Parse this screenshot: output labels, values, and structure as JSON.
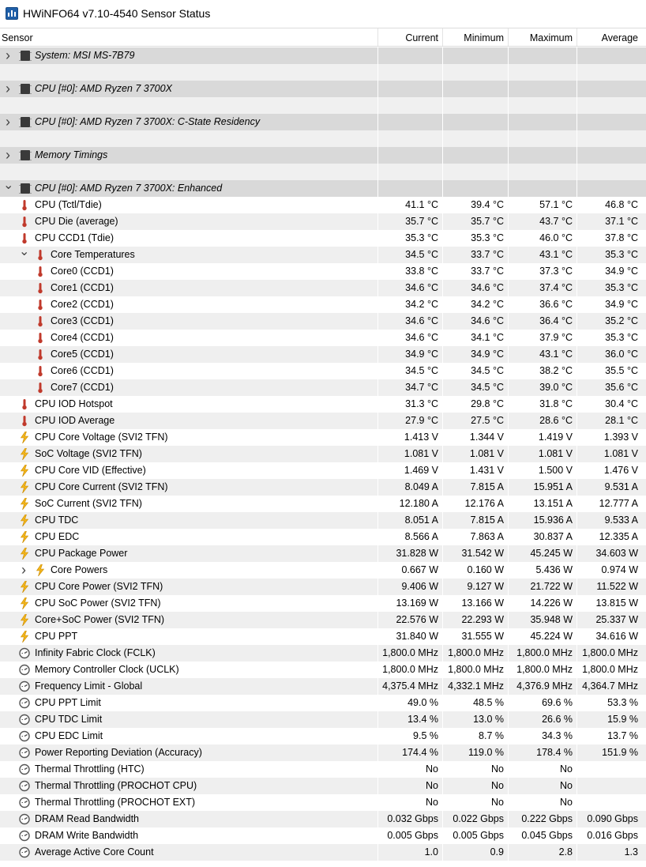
{
  "window": {
    "title": "HWiNFO64 v7.10-4540 Sensor Status"
  },
  "header": {
    "sensor": "Sensor",
    "current": "Current",
    "minimum": "Minimum",
    "maximum": "Maximum",
    "average": "Average"
  },
  "groups": [
    {
      "label": "System: MSI MS-7B79",
      "expanded": false
    },
    {
      "label": "CPU [#0]: AMD Ryzen 7 3700X",
      "expanded": false
    },
    {
      "label": "CPU [#0]: AMD Ryzen 7 3700X: C-State Residency",
      "expanded": false
    },
    {
      "label": "Memory Timings",
      "expanded": false
    },
    {
      "label": "CPU [#0]: AMD Ryzen 7 3700X: Enhanced",
      "expanded": true
    }
  ],
  "rows": [
    {
      "name": "CPU (Tctl/Tdie)",
      "icon": "thermometer-icon",
      "indent": 0,
      "current": "41.1 °C",
      "minimum": "39.4 °C",
      "maximum": "57.1 °C",
      "average": "46.8 °C"
    },
    {
      "name": "CPU Die (average)",
      "icon": "thermometer-icon",
      "indent": 0,
      "current": "35.7 °C",
      "minimum": "35.7 °C",
      "maximum": "43.7 °C",
      "average": "37.1 °C"
    },
    {
      "name": "CPU CCD1 (Tdie)",
      "icon": "thermometer-icon",
      "indent": 0,
      "current": "35.3 °C",
      "minimum": "35.3 °C",
      "maximum": "46.0 °C",
      "average": "37.8 °C"
    },
    {
      "name": "Core Temperatures",
      "icon": "thermometer-icon",
      "indent": 1,
      "chevron": "down",
      "current": "34.5 °C",
      "minimum": "33.7 °C",
      "maximum": "43.1 °C",
      "average": "35.3 °C"
    },
    {
      "name": "Core0 (CCD1)",
      "icon": "thermometer-icon",
      "indent": 1,
      "current": "33.8 °C",
      "minimum": "33.7 °C",
      "maximum": "37.3 °C",
      "average": "34.9 °C"
    },
    {
      "name": "Core1 (CCD1)",
      "icon": "thermometer-icon",
      "indent": 1,
      "current": "34.6 °C",
      "minimum": "34.6 °C",
      "maximum": "37.4 °C",
      "average": "35.3 °C"
    },
    {
      "name": "Core2 (CCD1)",
      "icon": "thermometer-icon",
      "indent": 1,
      "current": "34.2 °C",
      "minimum": "34.2 °C",
      "maximum": "36.6 °C",
      "average": "34.9 °C"
    },
    {
      "name": "Core3 (CCD1)",
      "icon": "thermometer-icon",
      "indent": 1,
      "current": "34.6 °C",
      "minimum": "34.6 °C",
      "maximum": "36.4 °C",
      "average": "35.2 °C"
    },
    {
      "name": "Core4 (CCD1)",
      "icon": "thermometer-icon",
      "indent": 1,
      "current": "34.6 °C",
      "minimum": "34.1 °C",
      "maximum": "37.9 °C",
      "average": "35.3 °C"
    },
    {
      "name": "Core5 (CCD1)",
      "icon": "thermometer-icon",
      "indent": 1,
      "current": "34.9 °C",
      "minimum": "34.9 °C",
      "maximum": "43.1 °C",
      "average": "36.0 °C"
    },
    {
      "name": "Core6 (CCD1)",
      "icon": "thermometer-icon",
      "indent": 1,
      "current": "34.5 °C",
      "minimum": "34.5 °C",
      "maximum": "38.2 °C",
      "average": "35.5 °C"
    },
    {
      "name": "Core7 (CCD1)",
      "icon": "thermometer-icon",
      "indent": 1,
      "current": "34.7 °C",
      "minimum": "34.5 °C",
      "maximum": "39.0 °C",
      "average": "35.6 °C"
    },
    {
      "name": "CPU IOD Hotspot",
      "icon": "thermometer-icon",
      "indent": 0,
      "current": "31.3 °C",
      "minimum": "29.8 °C",
      "maximum": "31.8 °C",
      "average": "30.4 °C"
    },
    {
      "name": "CPU IOD Average",
      "icon": "thermometer-icon",
      "indent": 0,
      "current": "27.9 °C",
      "minimum": "27.5 °C",
      "maximum": "28.6 °C",
      "average": "28.1 °C"
    },
    {
      "name": "CPU Core Voltage (SVI2 TFN)",
      "icon": "lightning-icon",
      "indent": 0,
      "current": "1.413 V",
      "minimum": "1.344 V",
      "maximum": "1.419 V",
      "average": "1.393 V"
    },
    {
      "name": "SoC Voltage (SVI2 TFN)",
      "icon": "lightning-icon",
      "indent": 0,
      "current": "1.081 V",
      "minimum": "1.081 V",
      "maximum": "1.081 V",
      "average": "1.081 V"
    },
    {
      "name": "CPU Core VID (Effective)",
      "icon": "lightning-icon",
      "indent": 0,
      "current": "1.469 V",
      "minimum": "1.431 V",
      "maximum": "1.500 V",
      "average": "1.476 V"
    },
    {
      "name": "CPU Core Current (SVI2 TFN)",
      "icon": "lightning-icon",
      "indent": 0,
      "current": "8.049 A",
      "minimum": "7.815 A",
      "maximum": "15.951 A",
      "average": "9.531 A"
    },
    {
      "name": "SoC Current (SVI2 TFN)",
      "icon": "lightning-icon",
      "indent": 0,
      "current": "12.180 A",
      "minimum": "12.176 A",
      "maximum": "13.151 A",
      "average": "12.777 A"
    },
    {
      "name": "CPU TDC",
      "icon": "lightning-icon",
      "indent": 0,
      "current": "8.051 A",
      "minimum": "7.815 A",
      "maximum": "15.936 A",
      "average": "9.533 A"
    },
    {
      "name": "CPU EDC",
      "icon": "lightning-icon",
      "indent": 0,
      "current": "8.566 A",
      "minimum": "7.863 A",
      "maximum": "30.837 A",
      "average": "12.335 A"
    },
    {
      "name": "CPU Package Power",
      "icon": "lightning-icon",
      "indent": 0,
      "current": "31.828 W",
      "minimum": "31.542 W",
      "maximum": "45.245 W",
      "average": "34.603 W"
    },
    {
      "name": "Core Powers",
      "icon": "lightning-icon",
      "indent": 1,
      "chevron": "right",
      "current": "0.667 W",
      "minimum": "0.160 W",
      "maximum": "5.436 W",
      "average": "0.974 W"
    },
    {
      "name": "CPU Core Power (SVI2 TFN)",
      "icon": "lightning-icon",
      "indent": 0,
      "current": "9.406 W",
      "minimum": "9.127 W",
      "maximum": "21.722 W",
      "average": "11.522 W"
    },
    {
      "name": "CPU SoC Power (SVI2 TFN)",
      "icon": "lightning-icon",
      "indent": 0,
      "current": "13.169 W",
      "minimum": "13.166 W",
      "maximum": "14.226 W",
      "average": "13.815 W"
    },
    {
      "name": "Core+SoC Power (SVI2 TFN)",
      "icon": "lightning-icon",
      "indent": 0,
      "current": "22.576 W",
      "minimum": "22.293 W",
      "maximum": "35.948 W",
      "average": "25.337 W"
    },
    {
      "name": "CPU PPT",
      "icon": "lightning-icon",
      "indent": 0,
      "current": "31.840 W",
      "minimum": "31.555 W",
      "maximum": "45.224 W",
      "average": "34.616 W"
    },
    {
      "name": "Infinity Fabric Clock (FCLK)",
      "icon": "gauge-icon",
      "indent": 0,
      "current": "1,800.0 MHz",
      "minimum": "1,800.0 MHz",
      "maximum": "1,800.0 MHz",
      "average": "1,800.0 MHz"
    },
    {
      "name": "Memory Controller Clock (UCLK)",
      "icon": "gauge-icon",
      "indent": 0,
      "current": "1,800.0 MHz",
      "minimum": "1,800.0 MHz",
      "maximum": "1,800.0 MHz",
      "average": "1,800.0 MHz"
    },
    {
      "name": "Frequency Limit - Global",
      "icon": "gauge-icon",
      "indent": 0,
      "current": "4,375.4 MHz",
      "minimum": "4,332.1 MHz",
      "maximum": "4,376.9 MHz",
      "average": "4,364.7 MHz"
    },
    {
      "name": "CPU PPT Limit",
      "icon": "gauge-icon",
      "indent": 0,
      "current": "49.0 %",
      "minimum": "48.5 %",
      "maximum": "69.6 %",
      "average": "53.3 %"
    },
    {
      "name": "CPU TDC Limit",
      "icon": "gauge-icon",
      "indent": 0,
      "current": "13.4 %",
      "minimum": "13.0 %",
      "maximum": "26.6 %",
      "average": "15.9 %"
    },
    {
      "name": "CPU EDC Limit",
      "icon": "gauge-icon",
      "indent": 0,
      "current": "9.5 %",
      "minimum": "8.7 %",
      "maximum": "34.3 %",
      "average": "13.7 %"
    },
    {
      "name": "Power Reporting Deviation (Accuracy)",
      "icon": "gauge-icon",
      "indent": 0,
      "current": "174.4 %",
      "minimum": "119.0 %",
      "maximum": "178.4 %",
      "average": "151.9 %"
    },
    {
      "name": "Thermal Throttling (HTC)",
      "icon": "gauge-icon",
      "indent": 0,
      "current": "No",
      "minimum": "No",
      "maximum": "No",
      "average": ""
    },
    {
      "name": "Thermal Throttling (PROCHOT CPU)",
      "icon": "gauge-icon",
      "indent": 0,
      "current": "No",
      "minimum": "No",
      "maximum": "No",
      "average": ""
    },
    {
      "name": "Thermal Throttling (PROCHOT EXT)",
      "icon": "gauge-icon",
      "indent": 0,
      "current": "No",
      "minimum": "No",
      "maximum": "No",
      "average": ""
    },
    {
      "name": "DRAM Read Bandwidth",
      "icon": "gauge-icon",
      "indent": 0,
      "current": "0.032 Gbps",
      "minimum": "0.022 Gbps",
      "maximum": "0.222 Gbps",
      "average": "0.090 Gbps"
    },
    {
      "name": "DRAM Write Bandwidth",
      "icon": "gauge-icon",
      "indent": 0,
      "current": "0.005 Gbps",
      "minimum": "0.005 Gbps",
      "maximum": "0.045 Gbps",
      "average": "0.016 Gbps"
    },
    {
      "name": "Average Active Core Count",
      "icon": "gauge-icon",
      "indent": 0,
      "current": "1.0",
      "minimum": "0.9",
      "maximum": "2.8",
      "average": "1.3"
    }
  ],
  "colors": {
    "thermometer": "#c0392b",
    "lightning": "#f2b51c",
    "gauge": "#555555",
    "row_alt": "#efefef",
    "group_band": "#d9d9d9"
  }
}
